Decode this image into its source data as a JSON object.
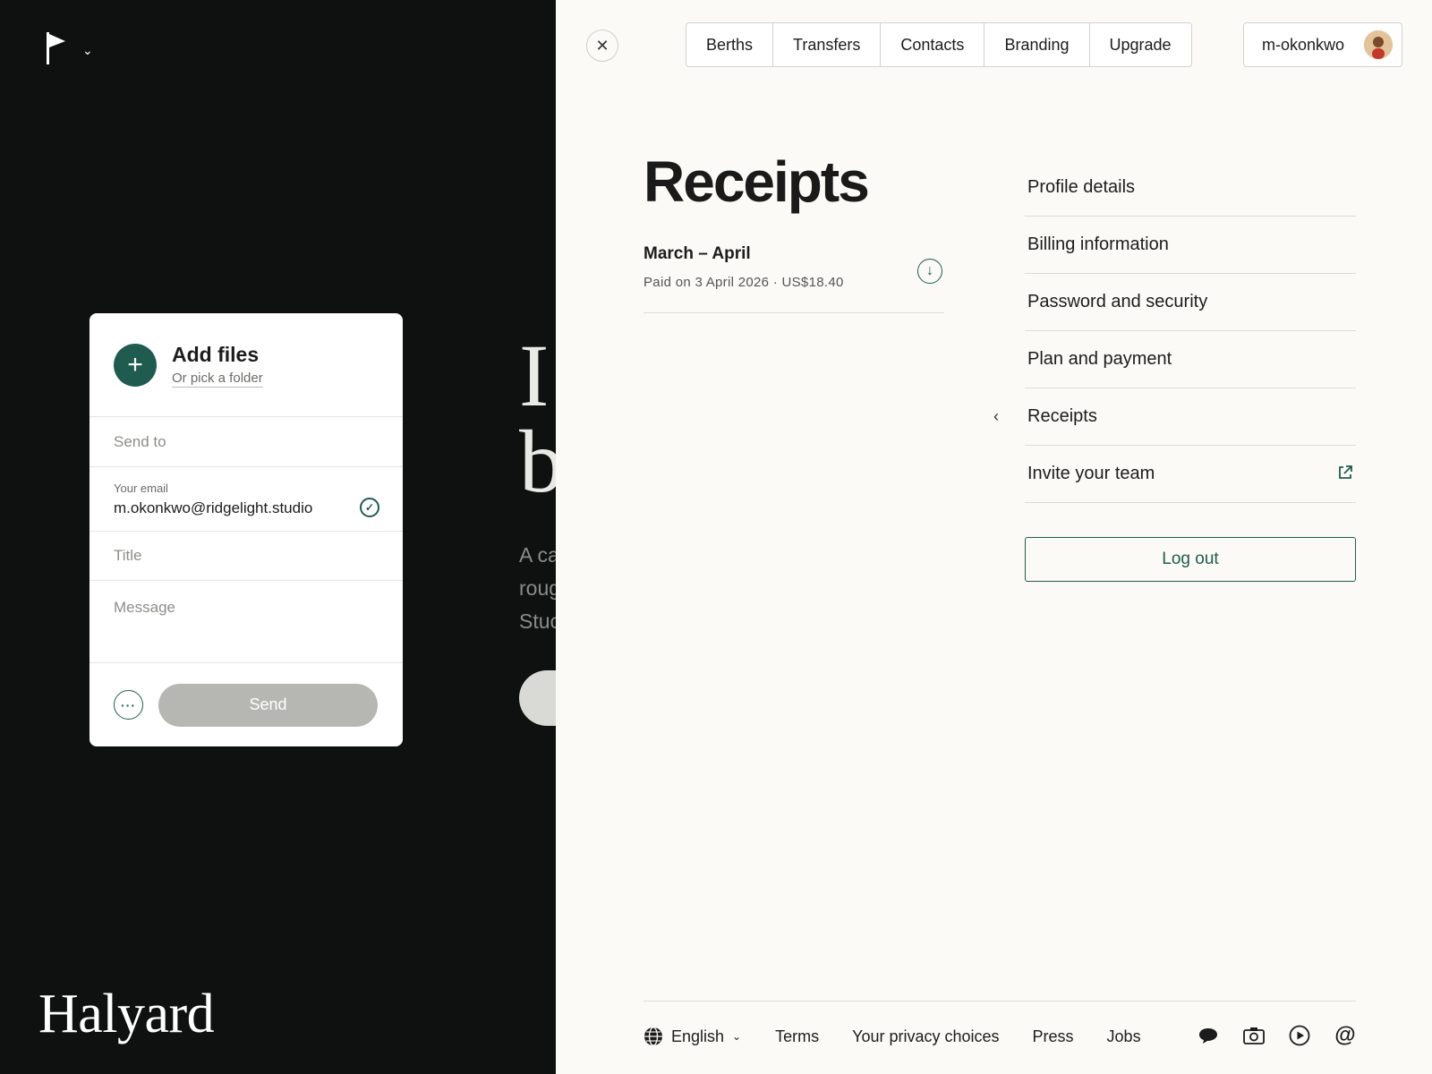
{
  "app": {
    "brand": "Halyard",
    "hero_text": "I\nb",
    "hero_sub": "A ca\nroug\nStuc"
  },
  "upload": {
    "add_title": "Add files",
    "pick_folder": "Or pick a folder",
    "send_to_placeholder": "Send to",
    "email_label": "Your email",
    "email_value": "m.okonkwo@ridgelight.studio",
    "title_placeholder": "Title",
    "message_placeholder": "Message",
    "send_label": "Send"
  },
  "nav": {
    "items": [
      {
        "label": "Berths"
      },
      {
        "label": "Transfers"
      },
      {
        "label": "Contacts"
      },
      {
        "label": "Branding"
      },
      {
        "label": "Upgrade"
      }
    ],
    "username": "m-okonkwo"
  },
  "page": {
    "title": "Receipts",
    "receipts": [
      {
        "period": "March – April",
        "paid": "Paid on 3 April 2026 · US$18.40"
      }
    ]
  },
  "menu": {
    "items": [
      {
        "label": "Profile details"
      },
      {
        "label": "Billing information"
      },
      {
        "label": "Password and security"
      },
      {
        "label": "Plan and payment"
      },
      {
        "label": "Receipts"
      },
      {
        "label": "Invite your team"
      }
    ],
    "logout_label": "Log out"
  },
  "footer": {
    "language": "English",
    "links": [
      {
        "label": "Terms"
      },
      {
        "label": "Your privacy choices"
      },
      {
        "label": "Press"
      },
      {
        "label": "Jobs"
      }
    ],
    "social_icons": [
      "chat-icon",
      "camera-icon",
      "play-icon",
      "at-icon"
    ]
  },
  "colors": {
    "accent": "#1f5c4f",
    "dark_bg": "#0f1111",
    "panel_bg": "#fbfaf7"
  }
}
